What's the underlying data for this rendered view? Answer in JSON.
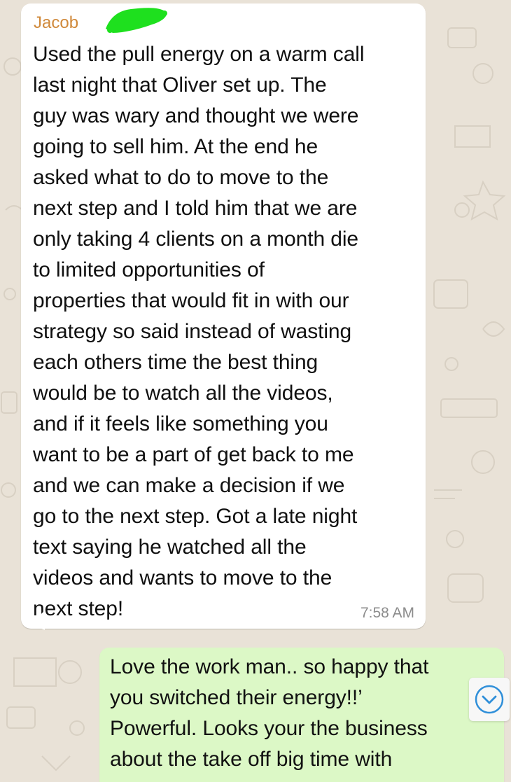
{
  "chat": {
    "incoming": {
      "sender": "Jacob",
      "text": "Used the pull energy on a warm call\nlast night that Oliver set up. The\nguy was wary and thought we were\ngoing to sell him. At the end he\nasked what to do to move to the\nnext step and I told him that we are\nonly taking 4 clients on a month die\nto limited opportunities of\nproperties that would fit in with our\nstrategy so said instead of wasting\neach others time the best thing\nwould be to watch all the videos,\nand if it feels like something you\nwant to be a part of get back to me\nand we can make a decision if we\ngo to the next step. Got a late night\ntext saying he watched all the\nvideos and wants to move to the\nnext step!",
      "time": "7:58 AM"
    },
    "outgoing": {
      "text": "Love the work man.. so happy that\nyou switched their energy!!’\nPowerful. Looks your the business\nabout the take off big time with"
    }
  },
  "colors": {
    "wallpaper": "#e9e2d7",
    "incoming_bubble": "#ffffff",
    "outgoing_bubble": "#dcf8c6",
    "sender_name": "#d0893a",
    "timestamp": "#8c8c8c",
    "redaction": "#1ee01e",
    "scroll_button_icon": "#2f8fd9"
  },
  "icons": {
    "scroll_down": "chevron-down-circle-icon"
  }
}
